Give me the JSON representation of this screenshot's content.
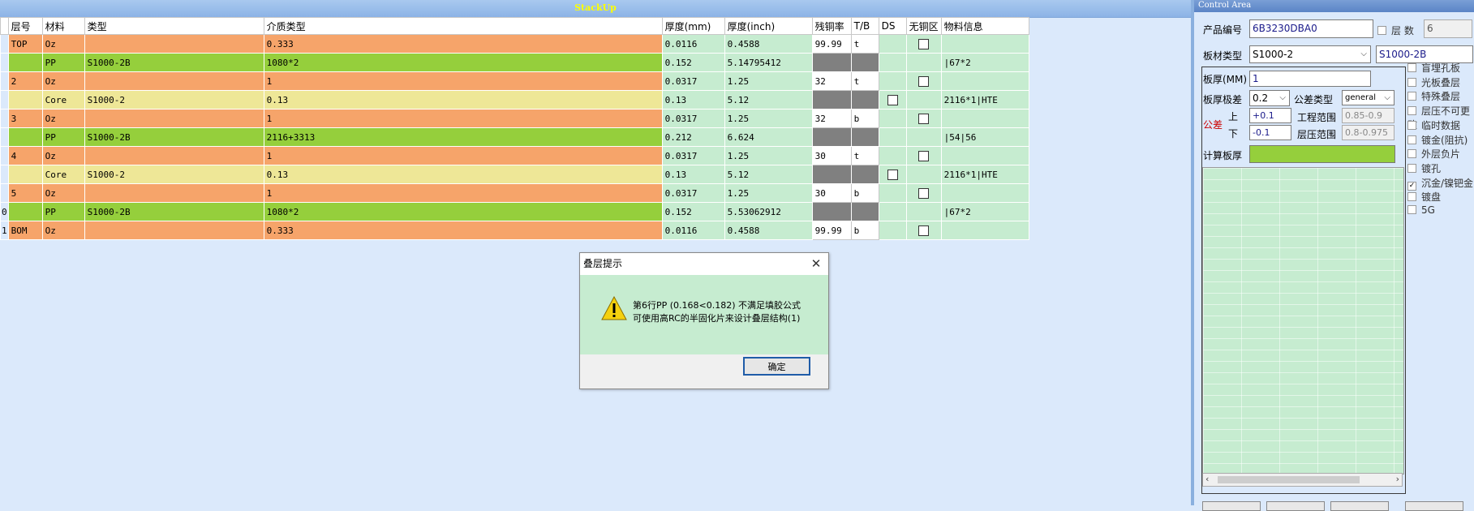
{
  "stackup": {
    "title": "StackUp",
    "headers": [
      "层号",
      "材料",
      "类型",
      "介质类型",
      "厚度(mm)",
      "厚度(inch)",
      "残铜率",
      "T/B",
      "DS",
      "无铜区",
      "物料信息"
    ],
    "rows": [
      {
        "idx": "",
        "layer": "TOP",
        "material": "Oz",
        "type": "",
        "dielectric": "0.333",
        "mm": "0.0116",
        "inch": "0.4588",
        "cu": "99.99",
        "tb": "t",
        "ds": "",
        "nocu": true,
        "info": "",
        "kind": "cu"
      },
      {
        "idx": "",
        "layer": "",
        "material": "PP",
        "type": "S1000-2B",
        "dielectric": "1080*2",
        "mm": "0.152",
        "inch": "5.14795412",
        "cu": "",
        "tb": "",
        "ds": "",
        "nocu": false,
        "info": "|67*2",
        "kind": "pp"
      },
      {
        "idx": "",
        "layer": "2",
        "material": "Oz",
        "type": "",
        "dielectric": "1",
        "mm": "0.0317",
        "inch": "1.25",
        "cu": "32",
        "tb": "t",
        "ds": "",
        "nocu": true,
        "info": "",
        "kind": "cu"
      },
      {
        "idx": "",
        "layer": "",
        "material": "Core",
        "type": "S1000-2",
        "dielectric": "0.13",
        "mm": "0.13",
        "inch": "5.12",
        "cu": "",
        "tb": "",
        "ds": "box",
        "nocu": false,
        "info": "2116*1|HTE",
        "kind": "core"
      },
      {
        "idx": "",
        "layer": "3",
        "material": "Oz",
        "type": "",
        "dielectric": "1",
        "mm": "0.0317",
        "inch": "1.25",
        "cu": "32",
        "tb": "b",
        "ds": "",
        "nocu": true,
        "info": "",
        "kind": "cu"
      },
      {
        "idx": "",
        "layer": "",
        "material": "PP",
        "type": "S1000-2B",
        "dielectric": "2116+3313",
        "mm": "0.212",
        "inch": "6.624",
        "cu": "",
        "tb": "",
        "ds": "",
        "nocu": false,
        "info": "|54|56",
        "kind": "pp"
      },
      {
        "idx": "",
        "layer": "4",
        "material": "Oz",
        "type": "",
        "dielectric": "1",
        "mm": "0.0317",
        "inch": "1.25",
        "cu": "30",
        "tb": "t",
        "ds": "",
        "nocu": true,
        "info": "",
        "kind": "cu"
      },
      {
        "idx": "",
        "layer": "",
        "material": "Core",
        "type": "S1000-2",
        "dielectric": "0.13",
        "mm": "0.13",
        "inch": "5.12",
        "cu": "",
        "tb": "",
        "ds": "box",
        "nocu": false,
        "info": "2116*1|HTE",
        "kind": "core"
      },
      {
        "idx": "",
        "layer": "5",
        "material": "Oz",
        "type": "",
        "dielectric": "1",
        "mm": "0.0317",
        "inch": "1.25",
        "cu": "30",
        "tb": "b",
        "ds": "",
        "nocu": true,
        "info": "",
        "kind": "cu"
      },
      {
        "idx": "0",
        "layer": "",
        "material": "PP",
        "type": "S1000-2B",
        "dielectric": "1080*2",
        "mm": "0.152",
        "inch": "5.53062912",
        "cu": "",
        "tb": "",
        "ds": "",
        "nocu": false,
        "info": "|67*2",
        "kind": "pp"
      },
      {
        "idx": "1",
        "layer": "BOM",
        "material": "Oz",
        "type": "",
        "dielectric": "0.333",
        "mm": "0.0116",
        "inch": "0.4588",
        "cu": "99.99",
        "tb": "b",
        "ds": "",
        "nocu": true,
        "info": "",
        "kind": "cu"
      }
    ]
  },
  "dialog": {
    "title": "叠层提示",
    "line1": "第6行PP (0.168<0.182) 不满足填胶公式",
    "line2": "可使用高RC的半固化片来设计叠层结构(1)",
    "ok": "确定",
    "close_icon": "close-icon",
    "warning_icon": "warning-icon"
  },
  "control": {
    "title": "Control Area",
    "product_label": "产品编号",
    "product_value": "6B3230DBA0",
    "layers_label": "层 数",
    "layers_value": "6",
    "material_label": "板材类型",
    "material_value": "S1000-2",
    "material_value2": "S1000-2B",
    "thickness_label": "板厚(MM)",
    "thickness_value": "1",
    "tol_label": "板厚极差",
    "tol_value": "0.2",
    "tol_type_label": "公差类型",
    "tol_type_value": "general",
    "gongcha": "公差",
    "upper": "上",
    "lower": "下",
    "upper_value": "+0.1",
    "lower_value": "-0.1",
    "eng_range_label": "工程范围",
    "eng_range_value": "0.85-0.9",
    "press_range_label": "层压范围",
    "press_range_value": "0.8-0.975",
    "calc_label": "计算板厚",
    "options": [
      {
        "label": "盲埋孔板",
        "checked": false
      },
      {
        "label": "光板叠层",
        "checked": false
      },
      {
        "label": "特殊叠层",
        "checked": false
      },
      {
        "label": "层压不可更改",
        "checked": false
      },
      {
        "label": "临时数据",
        "checked": false
      },
      {
        "label": "镀金(阻抗)",
        "checked": false
      },
      {
        "label": "外层负片",
        "checked": false
      },
      {
        "label": "镀孔",
        "checked": false
      },
      {
        "label": "沉金/镍钯金",
        "checked": true
      },
      {
        "label": "镀盘",
        "checked": false
      },
      {
        "label": "5G",
        "checked": false
      }
    ],
    "accent": "#95cf3c"
  }
}
